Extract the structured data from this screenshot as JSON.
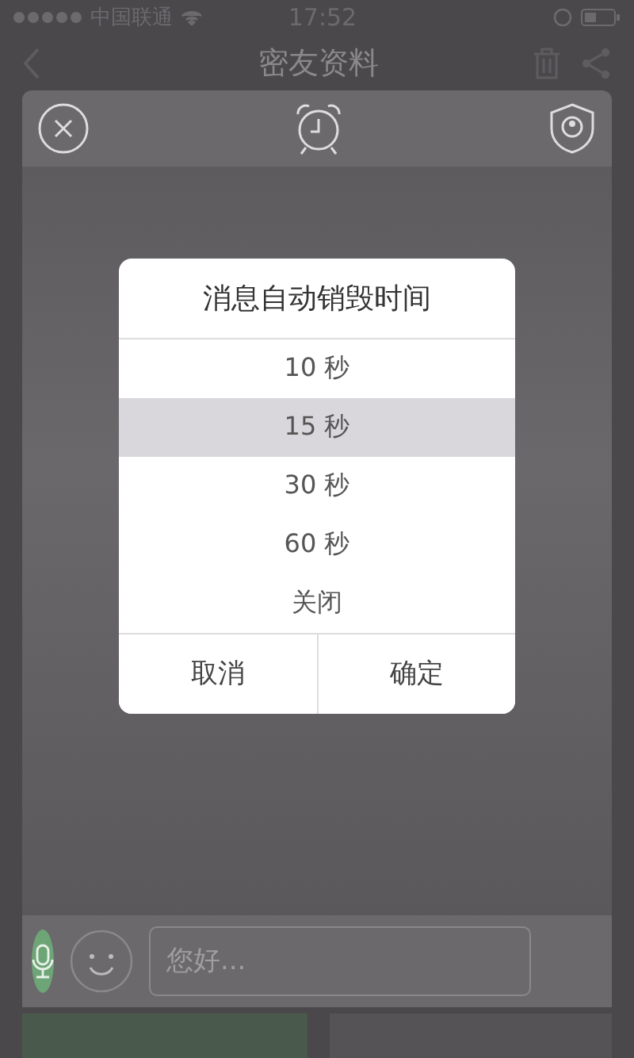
{
  "status_bar": {
    "carrier": "中国联通",
    "time": "17:52"
  },
  "nav": {
    "title": "密友资料"
  },
  "dialog": {
    "title": "消息自动销毁时间",
    "options": [
      {
        "label": "10 秒",
        "selected": false
      },
      {
        "label": "15 秒",
        "selected": true
      },
      {
        "label": "30 秒",
        "selected": false
      },
      {
        "label": "60 秒",
        "selected": false
      },
      {
        "label": "关闭",
        "selected": false
      }
    ],
    "buttons": [
      "取消",
      "确定"
    ]
  },
  "input_bar": {
    "placeholder": "您好..."
  }
}
